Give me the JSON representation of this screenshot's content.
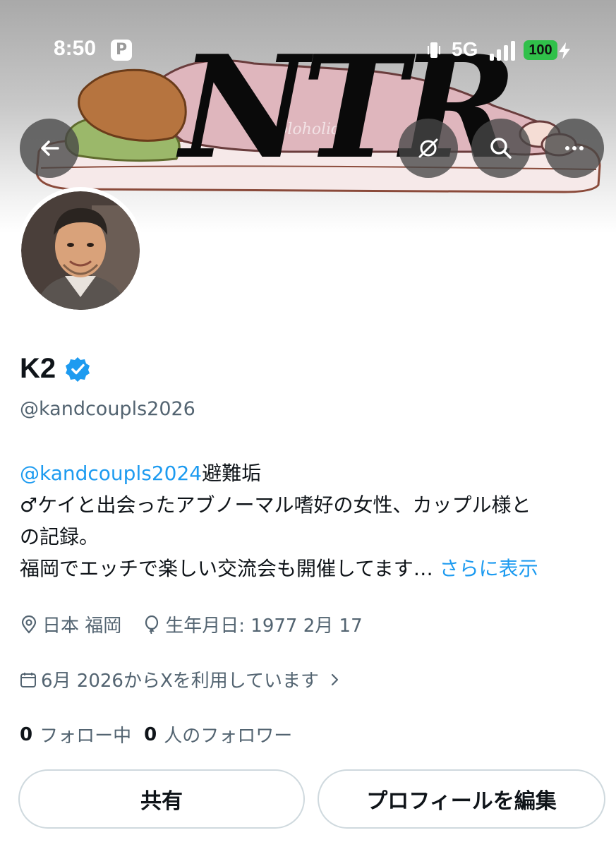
{
  "status_bar": {
    "time": "8:50",
    "app_badge": "P",
    "network": "5G",
    "battery": "100"
  },
  "header": {
    "banner_title": "NTR",
    "banner_watermark": "holoholiday"
  },
  "profile": {
    "display_name": "K2",
    "handle": "@kandcoupls2026",
    "bio": {
      "mention": "@kandcoupls2024",
      "line1_suffix": "避難垢",
      "line2": "♂ケイと出会ったアブノーマル嗜好の女性、カップル様と",
      "line3": "の記録。",
      "line4": "福岡でエッチで楽しい交流会も開催してます…",
      "show_more": "さらに表示"
    },
    "location": "日本 福岡",
    "birthday": "生年月日: 1977 2月 17",
    "joined": "6月 2026からXを利用しています",
    "following_count": "0",
    "following_label": "フォロー中",
    "followers_count": "0",
    "followers_label": "人のフォロワー"
  },
  "buttons": {
    "share": "共有",
    "edit_profile": "プロフィールを編集"
  },
  "colors": {
    "link": "#1d9bf0",
    "verified": "#1d9bf0",
    "secondary_text": "#536471"
  }
}
